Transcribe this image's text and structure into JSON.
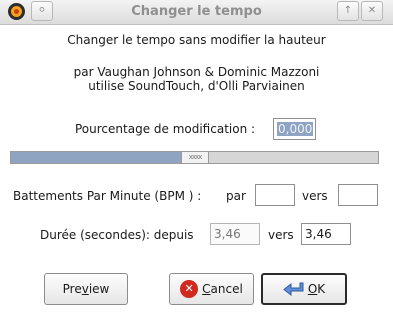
{
  "window": {
    "title": "Changer le tempo",
    "pin_glyph": "⚪",
    "up_glyph": "↑",
    "close_glyph": "✕"
  },
  "header": {
    "line1": "Changer le tempo sans modifier la hauteur",
    "line2": "par Vaughan Johnson & Dominic Mazzoni",
    "line3": "utilise SoundTouch, d'Olli Parviainen"
  },
  "percent": {
    "label": "Pourcentage de modification :",
    "value": "0,000"
  },
  "slider": {
    "position": 0.5,
    "thumb_glyph": "ⅹⅹⅹⅹ"
  },
  "bpm": {
    "label": "Battements Par Minute (BPM ) :",
    "from_label": "par",
    "from_value": "",
    "to_label": "vers",
    "to_value": ""
  },
  "duration": {
    "label": "Durée (secondes): depuis",
    "from_value": "3,46",
    "to_label": "vers",
    "to_value": "3,46"
  },
  "buttons": {
    "preview_pre": "Pre",
    "preview_mnemonic": "v",
    "preview_post": "iew",
    "cancel_mnemonic": "C",
    "cancel_post": "ancel",
    "ok_mnemonic": "O",
    "ok_post": "K"
  },
  "icons": {
    "app": "audacity-icon",
    "cancel": "cancel-icon",
    "ok": "ok-arrow-icon"
  },
  "colors": {
    "accent": "#8ea4c1",
    "cancel_red": "#d0291f",
    "ok_blue": "#3a72c4"
  }
}
